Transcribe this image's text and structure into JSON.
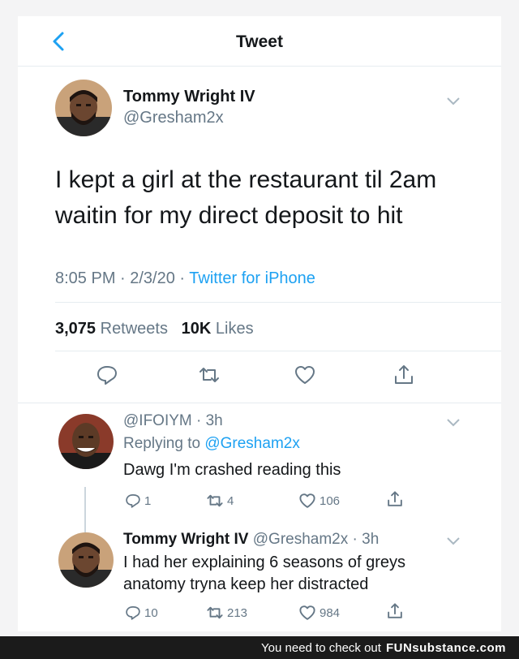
{
  "header": {
    "title": "Tweet"
  },
  "tweet": {
    "author_name": "Tommy Wright IV",
    "author_handle": "@Gresham2x",
    "text_line1": "I kept a girl at the restaurant til 2am",
    "text_line2": "waitin for my direct deposit to hit",
    "time": "8:05 PM · 2/3/20 · ",
    "source": "Twitter for iPhone",
    "retweets_count": "3,075",
    "retweets_label": " Retweets",
    "likes_count": "10K",
    "likes_label": " Likes"
  },
  "replies": [
    {
      "handle_time": "@IFOIYM · 3h",
      "replying_prefix": "Replying to ",
      "replying_to": "@Gresham2x",
      "text": "Dawg I'm crashed reading this",
      "reply_count": "1",
      "retweet_count": "4",
      "like_count": "106"
    },
    {
      "name": "Tommy Wright IV",
      "handle_time": " @Gresham2x · 3h",
      "text_line1": "I had her explaining 6 seasons of greys",
      "text_line2": "anatomy tryna keep her distracted",
      "reply_count": "10",
      "retweet_count": "213",
      "like_count": "984"
    }
  ],
  "footer": {
    "prefix": "You need to check out",
    "brand": "FUNsubstance.com"
  },
  "colors": {
    "accent": "#1da1f2",
    "secondary_text": "#657786",
    "icon_gray": "#657786"
  }
}
